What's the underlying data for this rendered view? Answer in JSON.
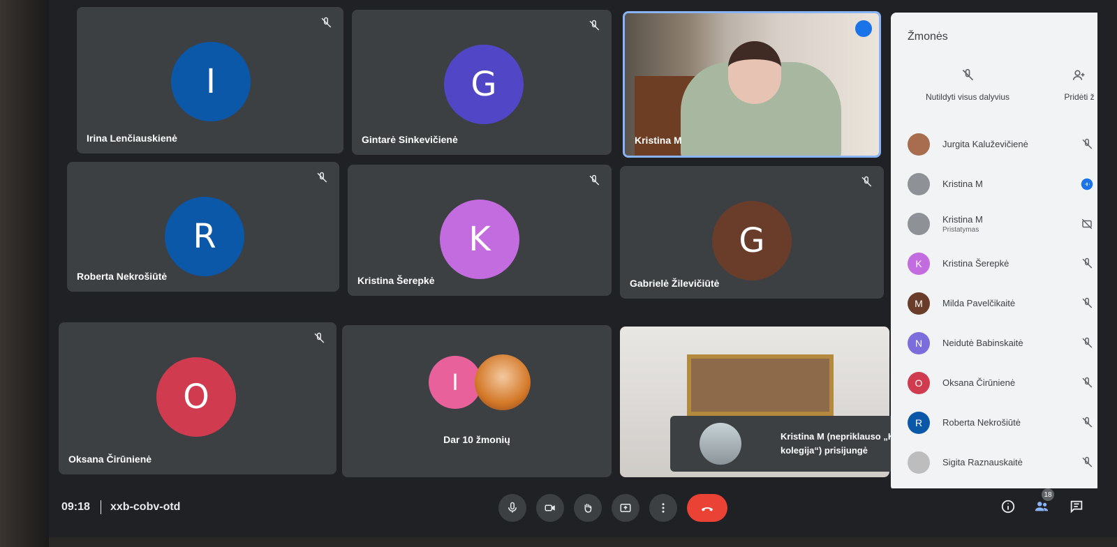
{
  "participants": [
    {
      "name": "Irina Lenčiauskienė",
      "initial": "I",
      "color": "#0b57a8"
    },
    {
      "name": "Gintarė Sinkevičienė",
      "initial": "G",
      "color": "#5146c6"
    },
    {
      "name": "Kristina M",
      "initial": "",
      "color": "#3c4043"
    },
    {
      "name": "Roberta Nekrošiūtė",
      "initial": "R",
      "color": "#0b57a8"
    },
    {
      "name": "Kristina Šerepkė",
      "initial": "K",
      "color": "#c36ce0"
    },
    {
      "name": "Gabrielė Žilevičiūtė",
      "initial": "G",
      "color": "#6a3d2b"
    },
    {
      "name": "Oksana Čirūnienė",
      "initial": "O",
      "color": "#d03b4f"
    }
  ],
  "more_tile": {
    "label": "Dar 10 žmonių",
    "initial": "I",
    "color": "#e8619a"
  },
  "toast": {
    "text": "Kristina M (nepriklauso „Kauno kolegija“) prisijungė"
  },
  "sidebar": {
    "title": "Žmonės",
    "mute_all_label": "Nutildyti visus dalyvius",
    "add_label": "Pridėti ž",
    "people": [
      {
        "name": "Jurgita Kaluževičienė",
        "initial": "",
        "color": "#a86d4e",
        "sub": "",
        "icon": "mic-off"
      },
      {
        "name": "Kristina M",
        "initial": "",
        "color": "#8e9196",
        "sub": "",
        "icon": "speaking"
      },
      {
        "name": "Kristina M",
        "initial": "",
        "color": "#8e9196",
        "sub": "Pristatymas",
        "icon": "present-off"
      },
      {
        "name": "Kristina Šerepkė",
        "initial": "K",
        "color": "#c36ce0",
        "sub": "",
        "icon": "mic-off"
      },
      {
        "name": "Milda Pavelčikaitė",
        "initial": "M",
        "color": "#6a3d2b",
        "sub": "",
        "icon": "mic-off"
      },
      {
        "name": "Neidutė Babinskaitė",
        "initial": "N",
        "color": "#7c6ddc",
        "sub": "",
        "icon": "mic-off"
      },
      {
        "name": "Oksana Čirūnienė",
        "initial": "O",
        "color": "#d03b4f",
        "sub": "",
        "icon": "mic-off"
      },
      {
        "name": "Roberta Nekrošiūtė",
        "initial": "R",
        "color": "#0b57a8",
        "sub": "",
        "icon": "mic-off"
      },
      {
        "name": "Sigita Raznauskaitė",
        "initial": "",
        "color": "#bdbdbd",
        "sub": "",
        "icon": "mic-off"
      }
    ]
  },
  "bottom": {
    "time": "09:18",
    "meeting_code": "xxb-cobv-otd",
    "people_count": "18"
  }
}
